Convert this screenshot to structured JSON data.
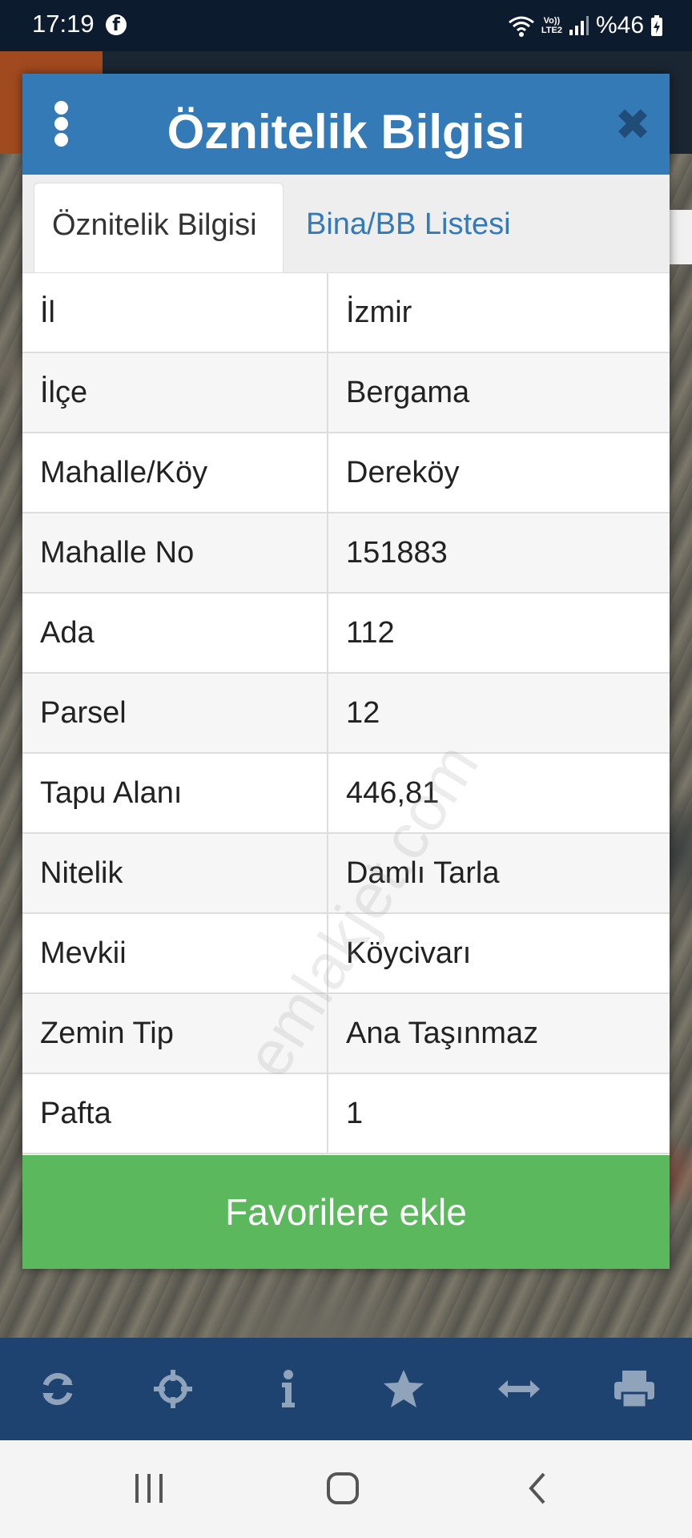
{
  "status_bar": {
    "time": "17:19",
    "battery": "%46",
    "network": "LTE2"
  },
  "dialog": {
    "title": "Öznitelik Bilgisi",
    "tabs": [
      {
        "label": "Öznitelik Bilgisi",
        "active": true
      },
      {
        "label": "Bina/BB Listesi",
        "active": false
      }
    ],
    "rows": [
      {
        "key": "İl",
        "value": "İzmir"
      },
      {
        "key": "İlçe",
        "value": "Bergama"
      },
      {
        "key": "Mahalle/Köy",
        "value": "Dereköy"
      },
      {
        "key": "Mahalle No",
        "value": "151883"
      },
      {
        "key": "Ada",
        "value": "112"
      },
      {
        "key": "Parsel",
        "value": "12"
      },
      {
        "key": "Tapu Alanı",
        "value": "446,81"
      },
      {
        "key": "Nitelik",
        "value": "Damlı Tarla"
      },
      {
        "key": "Mevkii",
        "value": "Köycivarı"
      },
      {
        "key": "Zemin Tip",
        "value": "Ana Taşınmaz"
      },
      {
        "key": "Pafta",
        "value": "1"
      }
    ],
    "favorite_button": "Favorilere ekle"
  },
  "watermark": "emlakjet.com",
  "toolbar": {
    "icons": [
      "refresh-icon",
      "crosshair-icon",
      "info-icon",
      "star-icon",
      "measure-icon",
      "print-icon"
    ]
  },
  "colors": {
    "header_blue": "#337ab7",
    "link_blue": "#337ab7",
    "button_green": "#5cb85c",
    "toolbar_bg": "#1e4370",
    "status_bar_bg": "#0d1b2e"
  }
}
